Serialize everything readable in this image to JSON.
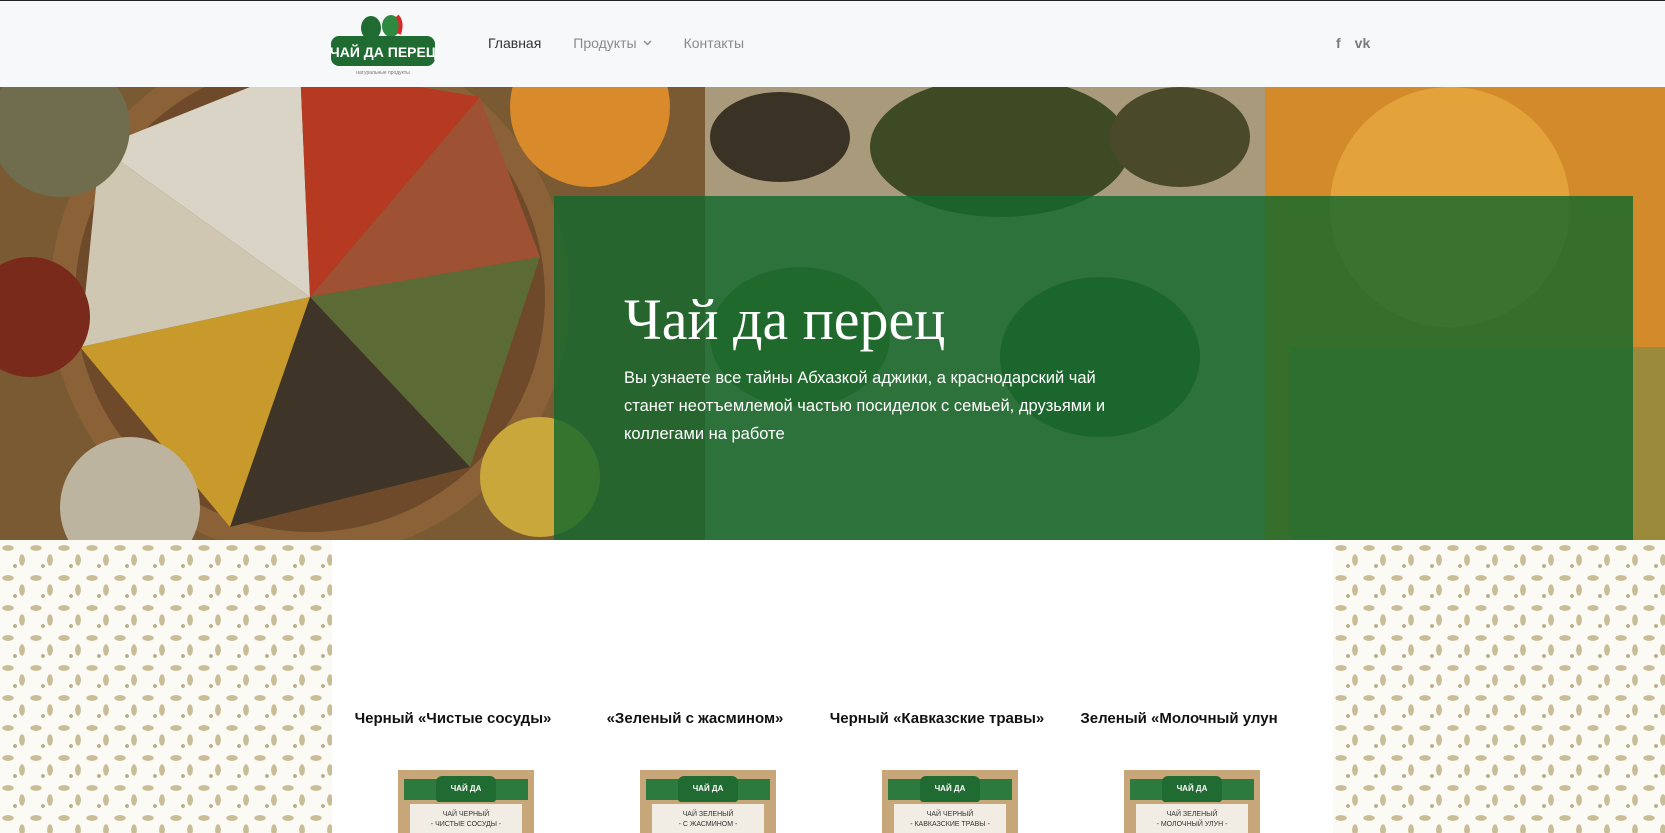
{
  "brand": {
    "logo_text": "ЧАЙ ДА ПЕРЕЦ",
    "logo_tagline": "натуральные продукты"
  },
  "nav": {
    "items": [
      {
        "label": "Главная"
      },
      {
        "label": "Продукты"
      },
      {
        "label": "Контакты"
      }
    ]
  },
  "social": {
    "facebook": "f",
    "vk": "vk"
  },
  "hero": {
    "title": "Чай да перец",
    "subtitle": "Вы узнаете все тайны Абхазкой аджики, а краснодарский чай станет неотъемлемой частью посиделок с семьей, друзьями и коллегами на работе"
  },
  "products": [
    {
      "title": "Черный «Чистые сосуды»",
      "pack_line1": "ЧАЙ ЧЕРНЫЙ",
      "pack_line2": "- ЧИСТЫЕ СОСУДЫ -"
    },
    {
      "title": "«Зеленый с жасмином»",
      "pack_line1": "ЧАЙ ЗЕЛЕНЫЙ",
      "pack_line2": "- С ЖАСМИНОМ -"
    },
    {
      "title": "Черный «Кавказские травы»",
      "pack_line1": "ЧАЙ ЧЕРНЫЙ",
      "pack_line2": "- КАВКАЗСКИЕ ТРАВЫ -"
    },
    {
      "title": "Зеленый «Молочный улун",
      "pack_line1": "ЧАЙ ЗЕЛЕНЫЙ",
      "pack_line2": "- МОЛОЧНЫЙ УЛУН -"
    }
  ],
  "colors": {
    "brand_green": "#14692d",
    "header_bg": "#f7f8f9"
  }
}
